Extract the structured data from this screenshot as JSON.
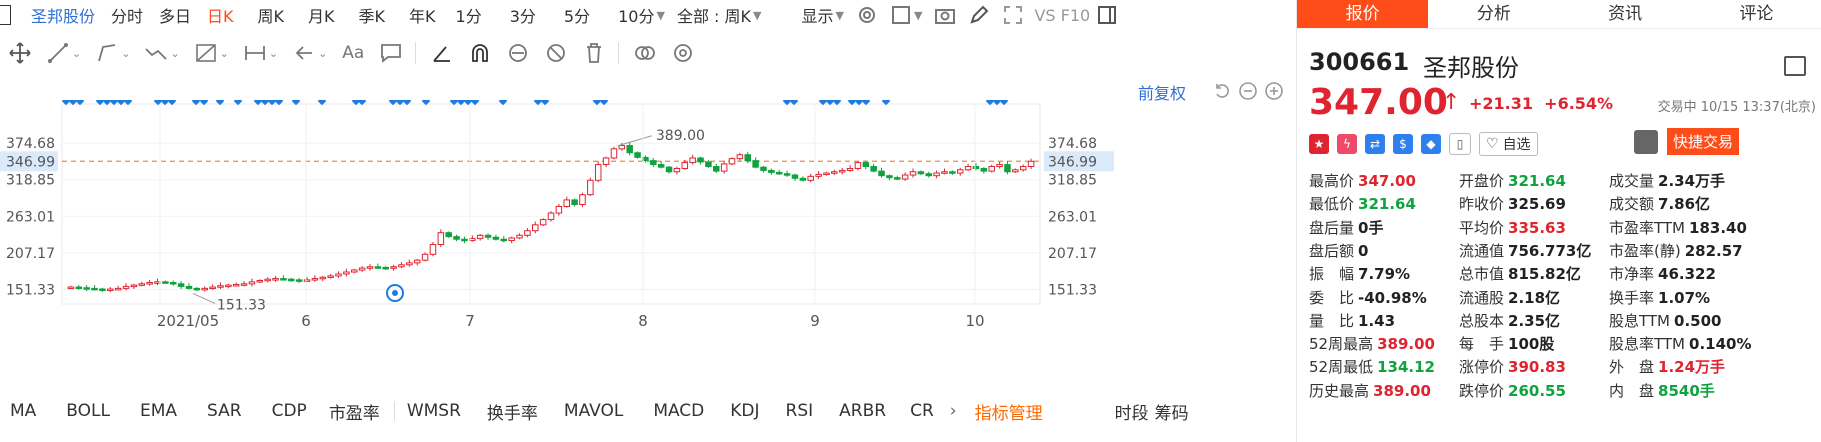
{
  "topbar": {
    "stock_name": "圣邦股份",
    "periods": [
      "分时",
      "多日",
      "日K",
      "周K",
      "月K",
      "季K",
      "年K",
      "1分",
      "3分",
      "5分",
      "10分"
    ],
    "active_period": "日K",
    "range_select": "全部 : 周K",
    "display_label": "显示",
    "vs_label": "VS F10"
  },
  "chart": {
    "adjust_label": "前复权",
    "y_ticks": [
      "374.68",
      "346.99",
      "318.85",
      "263.01",
      "207.17",
      "151.33"
    ],
    "x_ticks": [
      "2021/05",
      "6",
      "7",
      "8",
      "9",
      "10"
    ],
    "high_marker": "389.00",
    "low_marker": "151.33",
    "colors": {
      "up": "#e0242f",
      "down": "#0fa33f",
      "dash": "#f08a3c",
      "marker": "#1e7be0"
    }
  },
  "chart_data": {
    "type": "candlestick",
    "current_price_line": 346.99,
    "ylim": [
      120,
      410
    ],
    "y_ticks": [
      374.68,
      346.99,
      318.85,
      263.01,
      207.17,
      151.33
    ],
    "x_ticks": [
      "2021/05",
      "6",
      "7",
      "8",
      "9",
      "10"
    ],
    "annotations": {
      "high": 389.0,
      "low": 151.33
    },
    "closes": [
      155,
      154,
      153,
      152,
      151,
      152,
      153,
      156,
      158,
      160,
      162,
      163,
      162,
      160,
      156,
      153,
      152,
      153,
      155,
      157,
      158,
      159,
      160,
      163,
      165,
      167,
      168,
      167,
      166,
      165,
      166,
      168,
      170,
      172,
      175,
      178,
      181,
      184,
      186,
      185,
      184,
      186,
      189,
      192,
      196,
      205,
      220,
      238,
      232,
      228,
      226,
      229,
      234,
      231,
      228,
      226,
      230,
      234,
      241,
      250,
      258,
      268,
      278,
      288,
      281,
      296,
      318,
      342,
      352,
      366,
      371,
      360,
      353,
      348,
      342,
      338,
      331,
      336,
      345,
      352,
      346,
      339,
      332,
      343,
      351,
      357,
      348,
      338,
      333,
      330,
      328,
      326,
      321,
      318,
      324,
      327,
      329,
      331,
      333,
      336,
      345,
      339,
      332,
      325,
      322,
      320,
      326,
      331,
      328,
      325,
      329,
      331,
      329,
      334,
      339,
      336,
      332,
      339,
      342,
      331,
      334,
      339,
      347
    ]
  },
  "bottombar": {
    "indicators": [
      "MA",
      "BOLL",
      "EMA",
      "SAR",
      "CDP",
      "市盈率",
      "WMSR",
      "换手率",
      "MAVOL",
      "MACD",
      "KDJ",
      "RSI",
      "ARBR",
      "CR"
    ],
    "manage": "指标管理",
    "right_labels": [
      "时段",
      "筹码"
    ]
  },
  "right": {
    "tabs": [
      "报价",
      "分析",
      "资讯",
      "评论"
    ],
    "active_tab": "报价",
    "code": "300661",
    "name": "圣邦股份",
    "price": "347.00",
    "change": "+21.31",
    "change_pct": "+6.54%",
    "trade_status": "交易中 10/15 13:37(北京)",
    "watchlist": "自选",
    "quick_trade": "快捷交易",
    "stats": [
      {
        "label": "最高价",
        "value": "347.00",
        "color": "r"
      },
      {
        "label": "开盘价",
        "value": "321.64",
        "color": "g"
      },
      {
        "label": "成交量",
        "value": "2.34万手",
        "color": "k"
      },
      {
        "label": "最低价",
        "value": "321.64",
        "color": "g"
      },
      {
        "label": "昨收价",
        "value": "325.69",
        "color": "k"
      },
      {
        "label": "成交额",
        "value": "7.86亿",
        "color": "k"
      },
      {
        "label": "盘后量",
        "value": "0手",
        "color": "k"
      },
      {
        "label": "平均价",
        "value": "335.63",
        "color": "r"
      },
      {
        "label": "市盈率TTM",
        "value": "183.40",
        "color": "k"
      },
      {
        "label": "盘后额",
        "value": "0",
        "color": "k"
      },
      {
        "label": "流通值",
        "value": "756.773亿",
        "color": "k"
      },
      {
        "label": "市盈率(静)",
        "value": "282.57",
        "color": "k"
      },
      {
        "label": "振　幅",
        "value": "7.79%",
        "color": "k"
      },
      {
        "label": "总市值",
        "value": "815.82亿",
        "color": "k"
      },
      {
        "label": "市净率",
        "value": "46.322",
        "color": "k"
      },
      {
        "label": "委　比",
        "value": "-40.98%",
        "color": "k"
      },
      {
        "label": "流通股",
        "value": "2.18亿",
        "color": "k"
      },
      {
        "label": "换手率",
        "value": "1.07%",
        "color": "k"
      },
      {
        "label": "量　比",
        "value": "1.43",
        "color": "k"
      },
      {
        "label": "总股本",
        "value": "2.35亿",
        "color": "k"
      },
      {
        "label": "股息TTM",
        "value": "0.500",
        "color": "k"
      },
      {
        "label": "52周最高",
        "value": "389.00",
        "color": "r"
      },
      {
        "label": "每　手",
        "value": "100股",
        "color": "k"
      },
      {
        "label": "股息率TTM",
        "value": "0.140%",
        "color": "k"
      },
      {
        "label": "52周最低",
        "value": "134.12",
        "color": "g"
      },
      {
        "label": "涨停价",
        "value": "390.83",
        "color": "r"
      },
      {
        "label": "外　盘",
        "value": "1.24万手",
        "color": "r"
      },
      {
        "label": "历史最高",
        "value": "389.00",
        "color": "r"
      },
      {
        "label": "跌停价",
        "value": "260.55",
        "color": "g"
      },
      {
        "label": "内　盘",
        "value": "8540手",
        "color": "g"
      }
    ]
  }
}
